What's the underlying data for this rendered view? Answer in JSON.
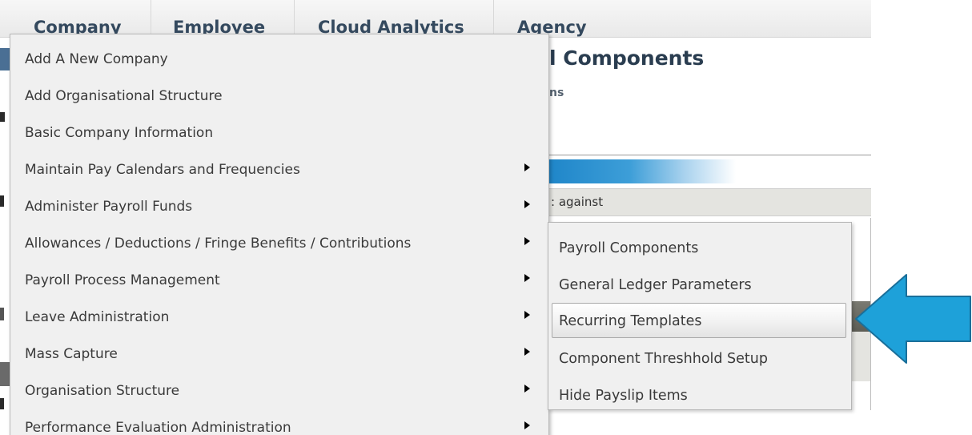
{
  "nav": {
    "tabs": [
      "Company",
      "Employee",
      "Cloud Analytics",
      "Agency"
    ]
  },
  "background": {
    "title": "l Components",
    "subtitle": "ns",
    "row_text": ": against"
  },
  "menu": {
    "items": [
      {
        "label": "Add A New Company",
        "has_submenu": false
      },
      {
        "label": "Add Organisational Structure",
        "has_submenu": false
      },
      {
        "label": "Basic Company Information",
        "has_submenu": false
      },
      {
        "label": "Maintain Pay Calendars and Frequencies",
        "has_submenu": true
      },
      {
        "label": "Administer Payroll Funds",
        "has_submenu": true
      },
      {
        "label": "Allowances / Deductions / Fringe Benefits / Contributions",
        "has_submenu": true
      },
      {
        "label": "Payroll Process Management",
        "has_submenu": true
      },
      {
        "label": "Leave Administration",
        "has_submenu": true
      },
      {
        "label": "Mass Capture",
        "has_submenu": true
      },
      {
        "label": "Organisation Structure",
        "has_submenu": true
      },
      {
        "label": "Performance Evaluation Administration",
        "has_submenu": true
      }
    ]
  },
  "submenu": {
    "items": [
      {
        "label": "Payroll Components",
        "hovered": false
      },
      {
        "label": "General Ledger Parameters",
        "hovered": false
      },
      {
        "label": "Recurring Templates",
        "hovered": true
      },
      {
        "label": "Component Threshhold Setup",
        "hovered": false
      },
      {
        "label": "Hide Payslip Items",
        "hovered": false
      }
    ]
  },
  "colors": {
    "callout_fill": "#1ea1d9",
    "callout_stroke": "#1a6f9a",
    "nav_text": "#34495e",
    "menu_bg": "#f0f0f0"
  }
}
